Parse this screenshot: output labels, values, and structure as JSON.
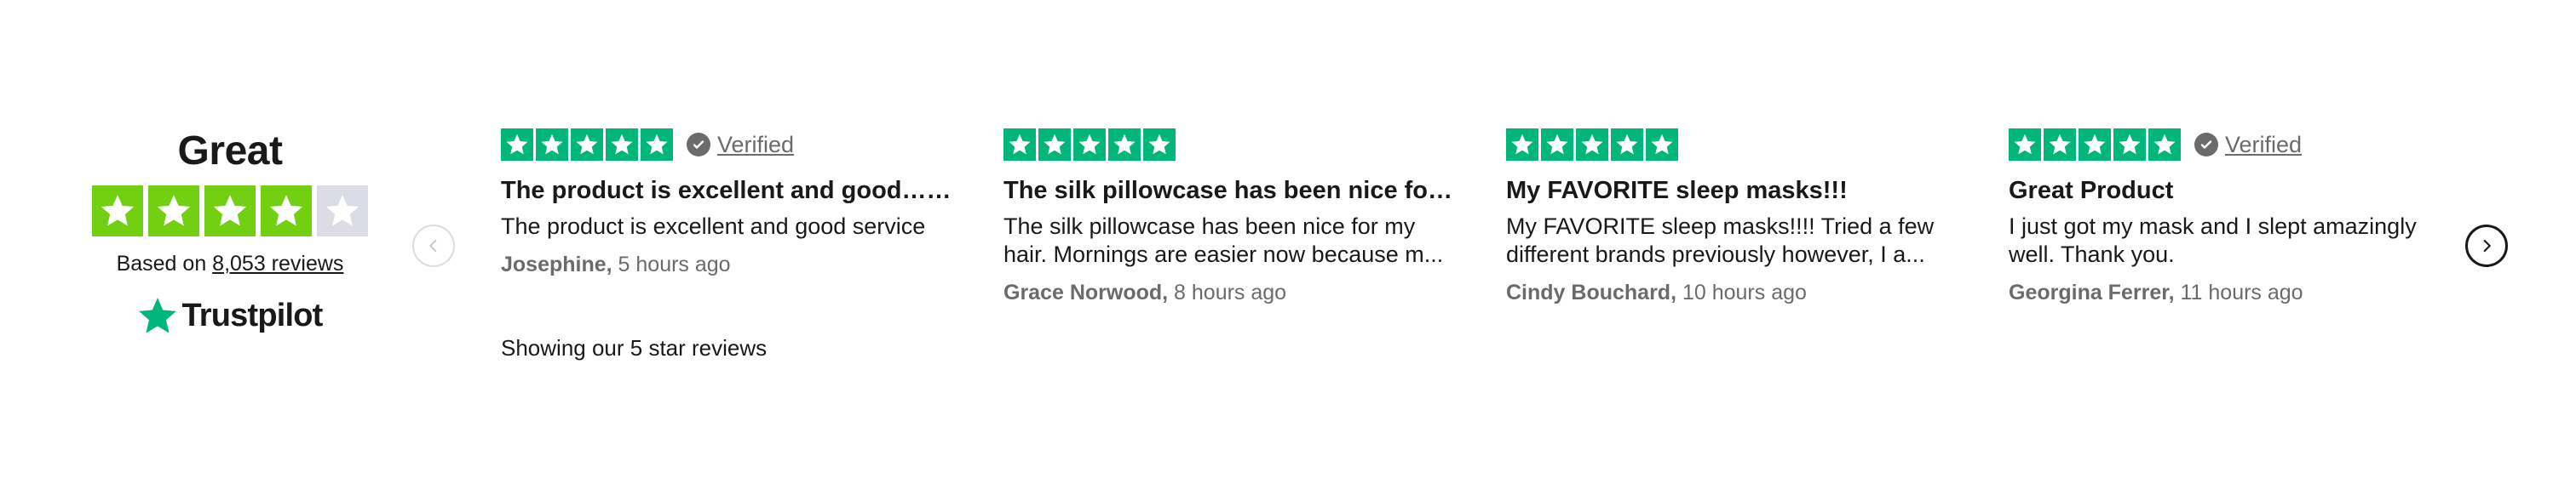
{
  "summary": {
    "rating_word": "Great",
    "star_rating": 4,
    "star_max": 5,
    "star_colors": {
      "filled": "#73cf11",
      "empty": "#dcdce6"
    },
    "based_on_label": "Based on",
    "reviews_count_link": "8,053 reviews",
    "brand_name": "Trustpilot",
    "brand_color": "#00b67a"
  },
  "navigation": {
    "prev_icon": "chevron-left-icon",
    "next_icon": "chevron-right-icon"
  },
  "reviews": [
    {
      "stars": 5,
      "verified": true,
      "verified_label": "Verified",
      "title": "The product is excellent and good……",
      "body": "The product is excellent and good service",
      "author": "Josephine,",
      "time": "5 hours ago"
    },
    {
      "stars": 5,
      "verified": false,
      "verified_label": "",
      "title": "The silk pillowcase has been nice for…",
      "body": "The silk pillowcase has been nice for my hair. Mornings are easier now because m...",
      "author": "Grace Norwood,",
      "time": "8 hours ago"
    },
    {
      "stars": 5,
      "verified": false,
      "verified_label": "",
      "title": "My FAVORITE sleep masks!!!",
      "body": "My FAVORITE sleep masks!!!! Tried a few different brands previously however, I a...",
      "author": "Cindy Bouchard,",
      "time": "10 hours ago"
    },
    {
      "stars": 5,
      "verified": true,
      "verified_label": "Verified",
      "title": "Great Product",
      "body": "I just got my mask and I slept amazingly well. Thank you.",
      "author": "Georgina Ferrer,",
      "time": "11 hours ago"
    }
  ],
  "footer": {
    "showing_text": "Showing our 5 star reviews"
  }
}
